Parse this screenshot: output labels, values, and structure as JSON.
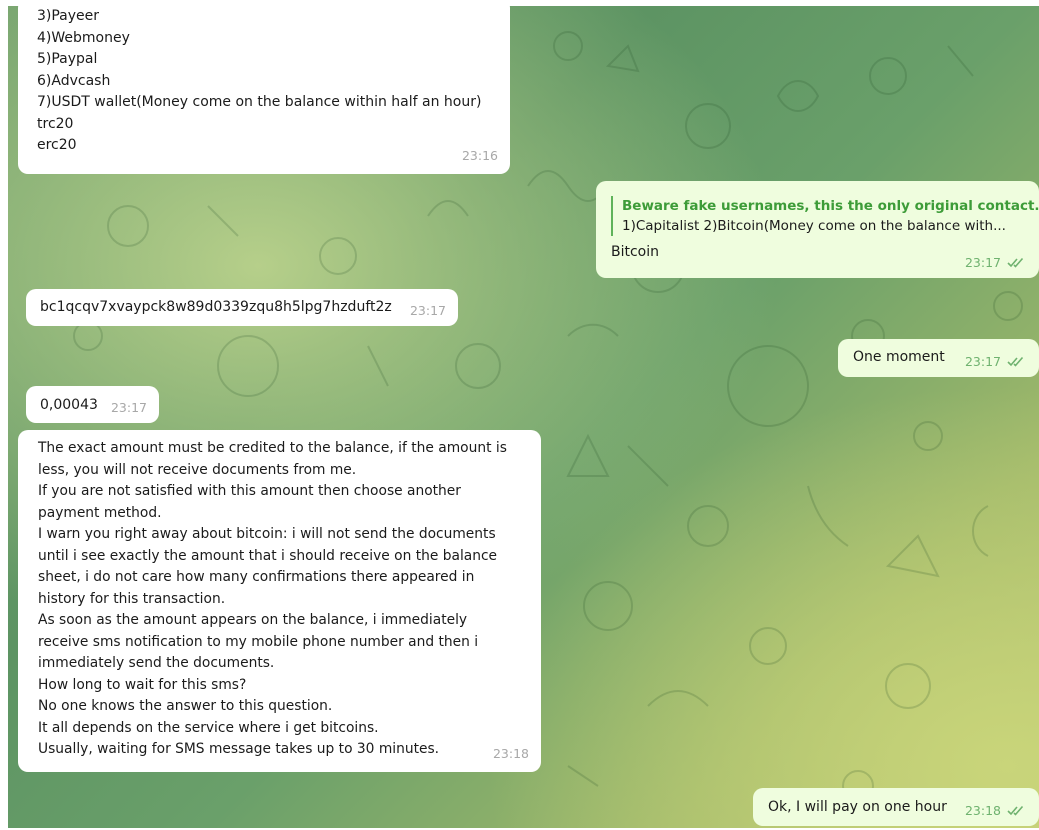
{
  "messages": {
    "m1": {
      "lines": [
        "3)Payeer",
        "4)Webmoney",
        "5)Paypal",
        "6)Advcash",
        "7)USDT wallet(Money come on the balance within half an hour)",
        "trc20",
        "erc20"
      ],
      "time": "23:16"
    },
    "m2": {
      "reply_title": "Beware fake usernames, this the only original contact.",
      "reply_text": "1)Capitalist  2)Bitcoin(Money come on the balance with...",
      "text": "Bitcoin",
      "time": "23:17"
    },
    "m3": {
      "text": "bc1qcqv7xvaypck8w89d0339zqu8h5lpg7hzduft2z",
      "time": "23:17"
    },
    "m4": {
      "text": "One moment",
      "time": "23:17"
    },
    "m5": {
      "text": "0,00043",
      "time": "23:17"
    },
    "m6": {
      "lines": [
        "The exact amount must be credited to the balance, if the amount is",
        "less, you will not receive documents from me.",
        "If you are not satisfied with this amount then choose another",
        "payment method.",
        "I warn you right away about bitcoin: i will not send the documents",
        "until i see exactly the amount that i should receive on the balance",
        "sheet, i do not care how many confirmations there appeared in",
        "history for this transaction.",
        "As soon as the amount appears on the balance, i immediately",
        "receive sms notification to my mobile phone number and then i",
        "immediately send the documents.",
        "How long to wait for this sms?",
        "No one knows the answer to this question.",
        "It all depends on the service where i get bitcoins.",
        "Usually, waiting for SMS message takes up to 30 minutes."
      ],
      "time": "23:18"
    },
    "m7": {
      "text": "Ok, I will pay on one hour",
      "time": "23:18"
    }
  },
  "icons": {
    "read_receipt": "double-check-icon"
  },
  "colors": {
    "incoming": "#ffffff",
    "outgoing": "#effdde",
    "reply_accent": "#3d9c38",
    "check": "#6fb26f"
  }
}
